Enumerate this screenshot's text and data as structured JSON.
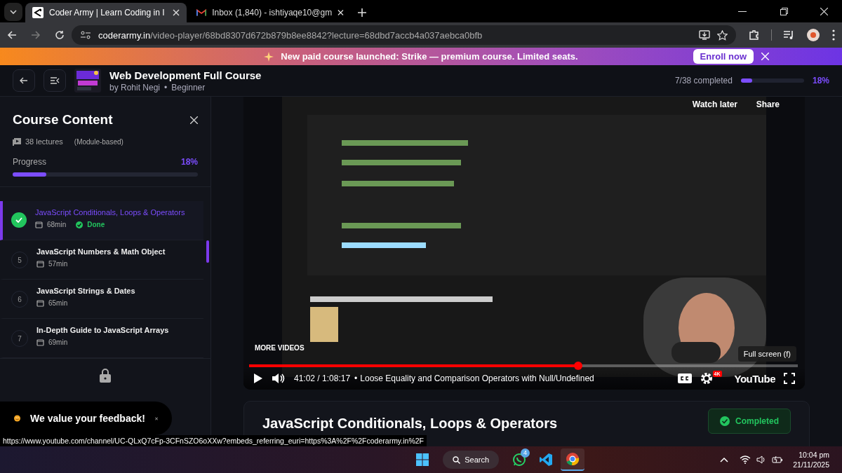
{
  "browser": {
    "tabs": [
      {
        "title": "Coder Army | Learn Coding in I",
        "selected": true
      },
      {
        "title": "Inbox (1,840) - ishtiyaqe10@gm",
        "selected": false
      }
    ],
    "url_host": "coderarmy.in",
    "url_path": "/video-player/68bd8307d672b879b8ee8842?lecture=68dbd7accb4a037aebca0bfb"
  },
  "banner": {
    "text": "New paid course launched: **Strike** — premium course. Limited seats.",
    "button": "Enroll now"
  },
  "header": {
    "title": "Web Development Full Course",
    "author": "by Rohit Negi",
    "separator": "•",
    "level_label": "Beginner",
    "completed": "7/38 completed",
    "progress": {
      "level": 0.18
    },
    "percent": "18%"
  },
  "sidebar": {
    "title": "Course Content",
    "lectures": "38 lectures",
    "mode": "(Module-based)",
    "progress_label": "Progress",
    "percent": "18%",
    "progress": {
      "level": 0.18
    },
    "items": [
      {
        "title": "JavaScript Conditionals, Loops & Operators",
        "duration": "68min",
        "done": true,
        "status": "Done",
        "selected": true
      },
      {
        "number": "5",
        "title": "JavaScript Numbers & Math Object",
        "duration": "57min",
        "done": false,
        "selected": false
      },
      {
        "number": "6",
        "title": "JavaScript Strings & Dates",
        "duration": "65min",
        "done": false,
        "selected": false
      },
      {
        "number": "7",
        "title": "In-Depth Guide to JavaScript Arrays",
        "duration": "69min",
        "done": false,
        "selected": false
      }
    ]
  },
  "toast": {
    "text": "We value your feedback!"
  },
  "video": {
    "watch_later": "Watch later",
    "share": "Share",
    "more_videos": "MORE VIDEOS",
    "tooltip": "Full screen (f)",
    "progress": {
      "level": 0.6
    },
    "time": "41:02 / 1:08:17",
    "separator": "•",
    "title": "Loose Equality and Comparison Operators with Null/Undefined",
    "quality": "4K",
    "logo": "YouTube"
  },
  "lecture_card": {
    "title": "JavaScript Conditionals, Loops & Operators",
    "status": "Completed"
  },
  "status_url": "https://www.youtube.com/channel/UC-QLxQ7cFp-3CFnSZO6oXXw?embeds_referring_euri=https%3A%2F%2Fcoderarmy.in%2F",
  "taskbar": {
    "search": "Search",
    "whatsapp_badge": "4",
    "time": "10:04 pm",
    "date": "21/11/2025"
  }
}
